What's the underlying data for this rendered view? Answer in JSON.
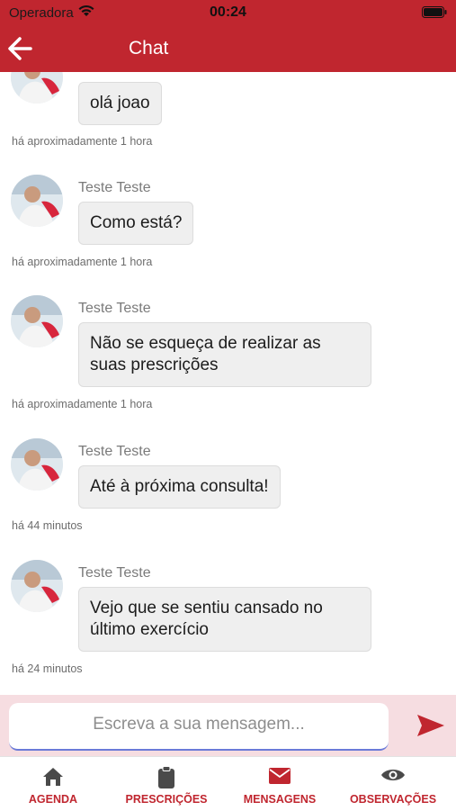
{
  "status_bar": {
    "carrier": "Operadora",
    "time": "00:24"
  },
  "header": {
    "title": "Chat",
    "back_icon": "arrow-left-icon"
  },
  "messages": [
    {
      "sender": "",
      "text": "olá joao",
      "time": "há aproximadamente 1 hora"
    },
    {
      "sender": "Teste Teste",
      "text": "Como está?",
      "time": "há aproximadamente 1 hora"
    },
    {
      "sender": "Teste Teste",
      "text": "Não se esqueça de realizar as suas prescrições",
      "time": "há aproximadamente 1 hora"
    },
    {
      "sender": "Teste Teste",
      "text": "Até à próxima consulta!",
      "time": "há 44 minutos"
    },
    {
      "sender": "Teste Teste",
      "text": "Vejo que se sentiu cansado no último exercício",
      "time": "há 24 minutos"
    }
  ],
  "composer": {
    "placeholder": "Escreva a sua mensagem...",
    "send_icon": "send-icon"
  },
  "tabs": [
    {
      "label": "AGENDA",
      "icon": "home-icon"
    },
    {
      "label": "PRESCRIÇÕES",
      "icon": "clipboard-icon"
    },
    {
      "label": "MENSAGENS",
      "icon": "envelope-icon"
    },
    {
      "label": "OBSERVAÇÕES",
      "icon": "eye-icon"
    }
  ],
  "colors": {
    "brand": "#c0262f",
    "bubble": "#efefef",
    "composer_bg": "#f6dde1"
  }
}
